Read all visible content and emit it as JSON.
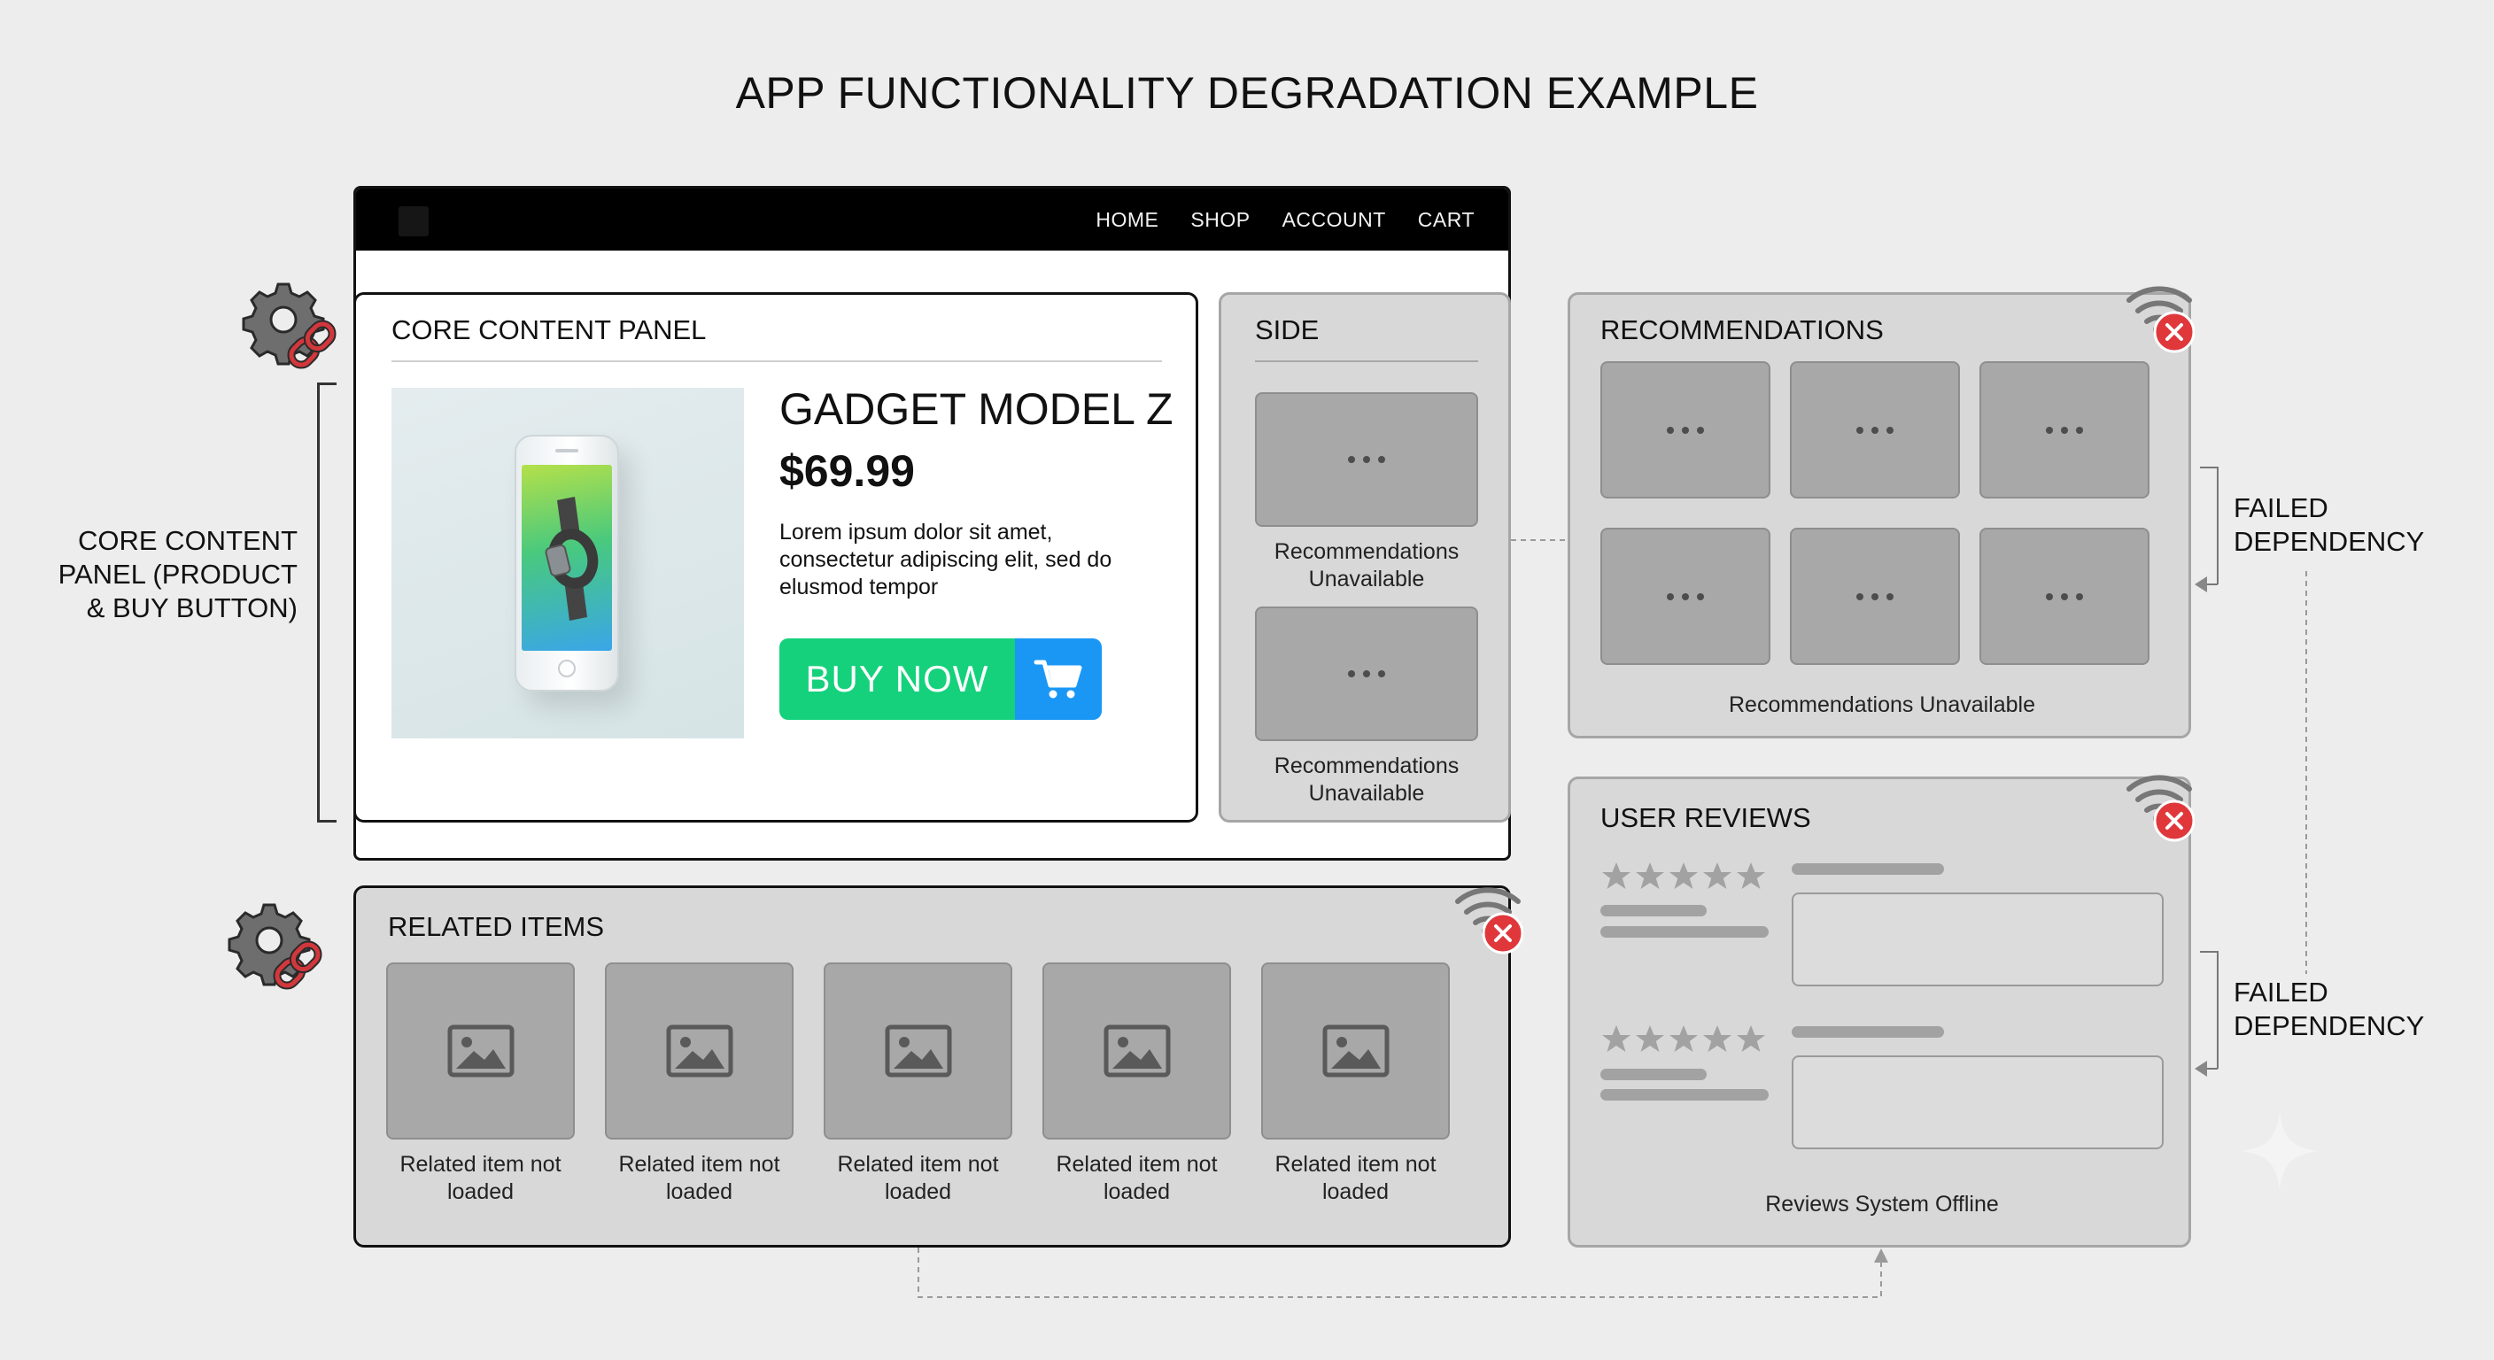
{
  "page": {
    "title": "APP FUNCTIONALITY DEGRADATION EXAMPLE"
  },
  "nav": {
    "links": [
      "HOME",
      "SHOP",
      "ACCOUNT",
      "CART"
    ]
  },
  "core_panel": {
    "title": "CORE CONTENT PANEL",
    "product_name": "GADGET MODEL Z",
    "price": "$69.99",
    "description": "Lorem ipsum dolor sit amet, consectetur adipiscing elit, sed do elusmod tempor",
    "buy_label": "BUY NOW"
  },
  "side_panel": {
    "title": "SIDE",
    "items": [
      {
        "caption": "Recommendations Unavailable"
      },
      {
        "caption": "Recommendations Unavailable"
      }
    ]
  },
  "recommendations": {
    "title": "RECOMMENDATIONS",
    "status": "Recommendations Unavailable"
  },
  "user_reviews": {
    "title": "USER REVIEWS",
    "status": "Reviews System Offline"
  },
  "related_items": {
    "title": "RELATED ITEMS",
    "items": [
      {
        "caption": "Related item not loaded"
      },
      {
        "caption": "Related item not loaded"
      },
      {
        "caption": "Related item not loaded"
      },
      {
        "caption": "Related item not loaded"
      },
      {
        "caption": "Related item not loaded"
      }
    ]
  },
  "annotations": {
    "core_label": "CORE CONTENT PANEL (PRODUCT & BUY BUTTON)",
    "failed_dependency_1": "FAILED DEPENDENCY",
    "failed_dependency_2": "FAILED DEPENDENCY"
  },
  "colors": {
    "buy_green": "#15d17c",
    "cart_blue": "#1a97f5",
    "error_red": "#e0373b",
    "degraded_grey": "#d8d8d8"
  },
  "icons": [
    "gear-link-icon",
    "wifi-error-icon",
    "cart-icon",
    "image-placeholder-icon",
    "star-icon",
    "sparkle-icon"
  ]
}
